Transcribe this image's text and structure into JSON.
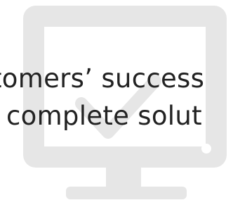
{
  "headline": {
    "line_1": "tomers’ success",
    "line_2": "complete solut"
  },
  "monitor_icon": {
    "name": "monitor-check-icon",
    "color": "#e6e6e6"
  },
  "colors": {
    "background": "#ffffff",
    "text": "#222222",
    "icon": "#e6e6e6"
  }
}
